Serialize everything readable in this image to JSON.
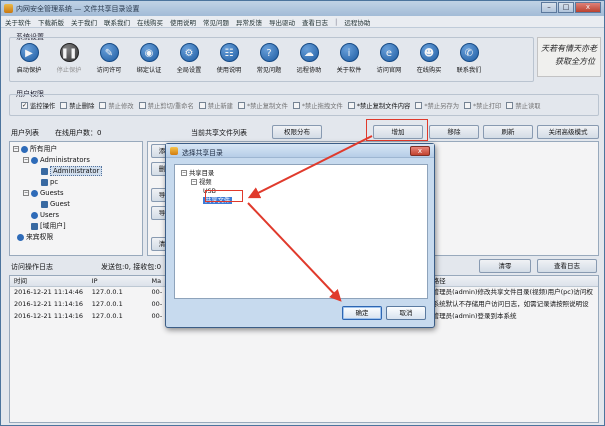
{
  "window": {
    "title": "内网安全管理系统 — 文件共享目录设置",
    "buttons": {
      "minimize": "–",
      "maximize": "□",
      "close": "x"
    }
  },
  "menu": {
    "items": [
      "关于软件",
      "下载新版",
      "关于我们",
      "联系我们",
      "在线购买",
      "使用说明",
      "常见问题",
      "异常反馈",
      "导出驱动",
      "查看日志"
    ],
    "separator": "|",
    "extra": "远程协助"
  },
  "system_settings": {
    "label": "系统设置",
    "tools": [
      {
        "label": "启动保护",
        "icon": "play"
      },
      {
        "label": "停止保护",
        "icon": "pause",
        "disabled": true
      },
      {
        "label": "访问许可",
        "icon": "pencil"
      },
      {
        "label": "绑定认证",
        "icon": "shield"
      },
      {
        "label": "全局设置",
        "icon": "gear"
      },
      {
        "label": "使用说明",
        "icon": "book"
      },
      {
        "label": "常见问题",
        "icon": "question"
      },
      {
        "label": "远程协助",
        "icon": "remote"
      },
      {
        "label": "关于软件",
        "icon": "info"
      },
      {
        "label": "访问官网",
        "icon": "globe"
      },
      {
        "label": "在线购买",
        "icon": "cart"
      },
      {
        "label": "联系我们",
        "icon": "phone"
      }
    ],
    "calligraphy": [
      "天若有情天亦老",
      "获取全方位"
    ]
  },
  "permissions": {
    "label": "用户权限",
    "items": [
      {
        "label": "监控操作",
        "checked": true
      },
      {
        "label": "禁止删除",
        "checked": false
      },
      {
        "label": "禁止修改",
        "checked": false,
        "dim": true
      },
      {
        "label": "禁止剪切/重命名",
        "checked": false,
        "dim": true
      },
      {
        "label": "禁止新建",
        "checked": false,
        "dim": true
      },
      {
        "label": "*禁止复制文件",
        "checked": false,
        "dim": true
      },
      {
        "label": "*禁止拖拽文件",
        "checked": false,
        "dim": true
      },
      {
        "label": "*禁止复制文件内容",
        "checked": false
      },
      {
        "label": "*禁止另存为",
        "checked": false,
        "dim": true
      },
      {
        "label": "*禁止打印",
        "checked": false,
        "dim": true
      },
      {
        "label": "禁止读取",
        "checked": false,
        "dim": true
      }
    ]
  },
  "user_list": {
    "label": "用户列表",
    "online_label": "在线用户数：0",
    "shared_list_label": "当前共享文件列表",
    "perm_dist_button": "权限分布",
    "add_button": "增加",
    "remove_button": "移除",
    "refresh_button": "刷新",
    "close_advanced_button": "关闭高级模式",
    "tree": [
      {
        "label": "所有用户",
        "level": 0,
        "expander": "−",
        "kind": "group"
      },
      {
        "label": "Administrators",
        "level": 1,
        "expander": "−",
        "kind": "group"
      },
      {
        "label": "Administrator",
        "level": 2,
        "kind": "user",
        "selected": true
      },
      {
        "label": "pc",
        "level": 2,
        "kind": "user"
      },
      {
        "label": "Guests",
        "level": 1,
        "expander": "−",
        "kind": "group"
      },
      {
        "label": "Guest",
        "level": 2,
        "kind": "user"
      },
      {
        "label": "Users",
        "level": 1,
        "kind": "group"
      },
      {
        "label": "[域用户]",
        "level": 1,
        "kind": "user"
      },
      {
        "label": "来宾权限",
        "level": 0,
        "kind": "group"
      }
    ],
    "side_buttons": [
      "添",
      "删",
      "导",
      "导",
      "清"
    ]
  },
  "log": {
    "label": "访问操作日志",
    "stats": "发送包:0, 接收包:0",
    "clear_button": "清零",
    "view_button": "查看日志",
    "columns": [
      "时间",
      "IP",
      "Ma",
      "路径"
    ],
    "rows": [
      {
        "time": "2016-12-21 11:14:46",
        "ip": "127.0.0.1",
        "mac": "00-",
        "desc": "管理员(admin)修改共享文件目录(视频)用户(pc)访问权"
      },
      {
        "time": "2016-12-21 11:14:16",
        "ip": "127.0.0.1",
        "mac": "00-",
        "desc": "系统默认不存储用户访问日志，如需记录请按照说明设"
      },
      {
        "time": "2016-12-21 11:14:16",
        "ip": "127.0.0.1",
        "mac": "00-",
        "desc": "管理员(admin)登录到本系统"
      }
    ]
  },
  "dialog": {
    "title": "选择共享目录",
    "close": "x",
    "tree": [
      {
        "label": "共享目录",
        "level": 0,
        "expander": "−"
      },
      {
        "label": "视频",
        "level": 1,
        "expander": "−"
      },
      {
        "label": "USB",
        "level": 2
      },
      {
        "label": "共享文件",
        "level": 2,
        "selected": true
      }
    ],
    "ok_button": "确定",
    "cancel_button": "取消"
  },
  "highlight_color": "#e03a2c"
}
